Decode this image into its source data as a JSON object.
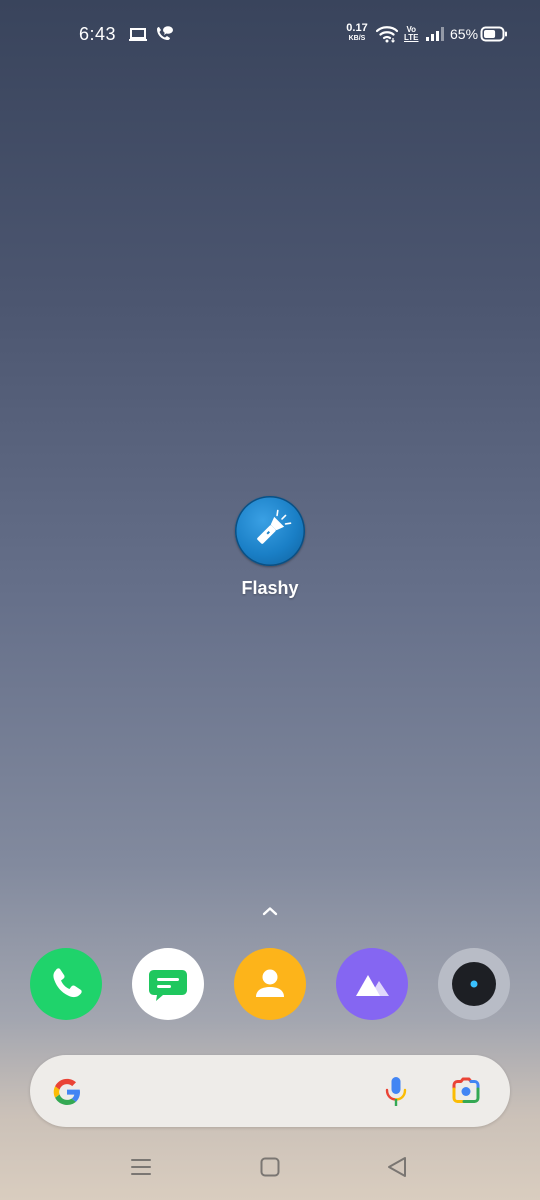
{
  "status_bar": {
    "time": "6:43",
    "network_speed_value": "0.17",
    "network_speed_unit": "KB/S",
    "volte_top": "Vo",
    "volte_bottom": "LTE",
    "battery_percent": "65%",
    "battery_level": 0.65,
    "icons": [
      "laptop-icon",
      "wifi-calling-icon",
      "wifi-icon",
      "volte-icon",
      "signal-icon",
      "battery-icon"
    ]
  },
  "home": {
    "apps": [
      {
        "label": "Flashy",
        "icon": "flashlight-icon",
        "color": "#1a7fc6"
      }
    ]
  },
  "dock": {
    "apps": [
      {
        "name": "phone",
        "icon": "phone-icon",
        "color": "#1fd36b"
      },
      {
        "name": "messages",
        "icon": "message-icon",
        "color": "#ffffff"
      },
      {
        "name": "contacts",
        "icon": "contact-icon",
        "color": "#fdb41a"
      },
      {
        "name": "gallery",
        "icon": "photos-icon",
        "color": "#8566f2"
      },
      {
        "name": "camera",
        "icon": "camera-icon",
        "color": "#b8bcc6"
      }
    ]
  },
  "search_bar": {
    "icons": [
      "google-logo-icon",
      "microphone-icon",
      "google-lens-icon"
    ]
  },
  "nav_bar": {
    "icons": [
      "recents-icon",
      "home-icon",
      "back-icon"
    ]
  }
}
